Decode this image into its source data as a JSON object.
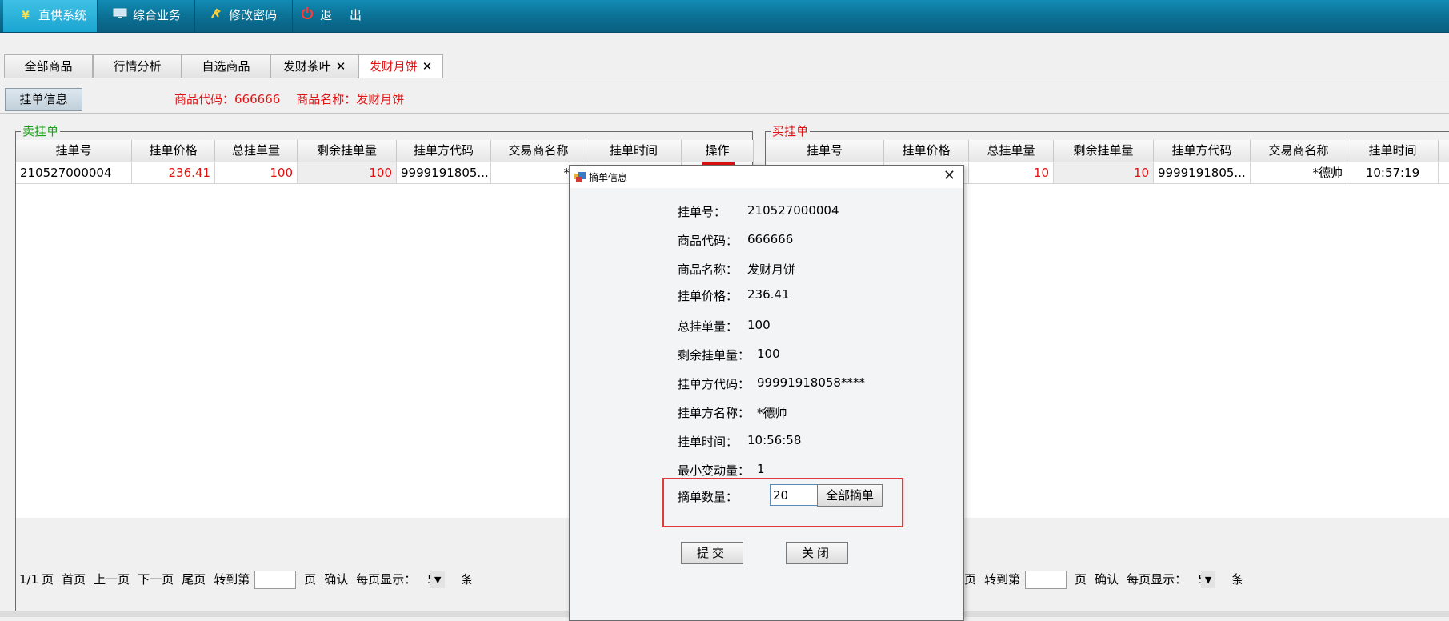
{
  "topbar": {
    "items": [
      {
        "label": "直供系统",
        "icon": "yen-icon"
      },
      {
        "label": "综合业务",
        "icon": "monitor-icon"
      },
      {
        "label": "修改密码",
        "icon": "key-icon"
      },
      {
        "label": "退出",
        "icon": "power-icon"
      }
    ]
  },
  "tabs": [
    {
      "label": "全部商品",
      "closable": false,
      "active": false
    },
    {
      "label": "行情分析",
      "closable": false,
      "active": false
    },
    {
      "label": "自选商品",
      "closable": false,
      "active": false
    },
    {
      "label": "发财茶叶",
      "closable": true,
      "active": false
    },
    {
      "label": "发财月饼",
      "closable": true,
      "active": true
    }
  ],
  "subbar": {
    "button_label": "挂单信息",
    "code_label": "商品代码：",
    "code_value": "666666",
    "name_label": "商品名称：",
    "name_value": "发财月饼"
  },
  "sell_panel": {
    "title": "卖挂单",
    "columns": [
      "挂单号",
      "挂单价格",
      "总挂单量",
      "剩余挂单量",
      "挂单方代码",
      "交易商名称",
      "挂单时间",
      "操作"
    ],
    "rows": [
      [
        "210527000004",
        "236.41",
        "100",
        "100",
        "9999191805...",
        "*德",
        "",
        ""
      ]
    ]
  },
  "buy_panel": {
    "title": "买挂单",
    "columns": [
      "挂单号",
      "挂单价格",
      "总挂单量",
      "剩余挂单量",
      "挂单方代码",
      "交易商名称",
      "挂单时间"
    ],
    "rows": [
      [
        "",
        "",
        "10",
        "10",
        "9999191805...",
        "*德帅",
        "10:57:19"
      ]
    ]
  },
  "pager": {
    "page_info": "1/1",
    "page_unit": "页",
    "first": "首页",
    "prev": "上一页",
    "next": "下一页",
    "last": "尾页",
    "goto_label": "转到第",
    "goto_unit": "页",
    "confirm": "确认",
    "per_page_label": "每页显示：",
    "per_page_value": "5",
    "per_page_unit": "条"
  },
  "dialog": {
    "title": "摘单信息",
    "fields": [
      {
        "label": "挂单号：",
        "value": "210527000004"
      },
      {
        "label": "商品代码：",
        "value": "666666"
      },
      {
        "label": "商品名称：",
        "value": "发财月饼"
      },
      {
        "label": "挂单价格：",
        "value": "236.41"
      },
      {
        "label": "总挂单量：",
        "value": "100"
      },
      {
        "label": "剩余挂单量：",
        "value": "100"
      },
      {
        "label": "挂单方代码：",
        "value": "99991918058****"
      },
      {
        "label": "挂单方名称：",
        "value": "*德帅"
      },
      {
        "label": "挂单时间：",
        "value": "10:56:58"
      },
      {
        "label": "最小变动量：",
        "value": "1"
      }
    ],
    "qty_label": "摘单数量：",
    "qty_value": "20",
    "all_button": "全部摘单",
    "submit_button": "提交",
    "close_button": "关闭"
  },
  "colors": {
    "accent_red": "#e01010",
    "sell_green": "#19a019",
    "topbar_blue": "#0b6f93",
    "highlight_red": "#e23a3a"
  }
}
